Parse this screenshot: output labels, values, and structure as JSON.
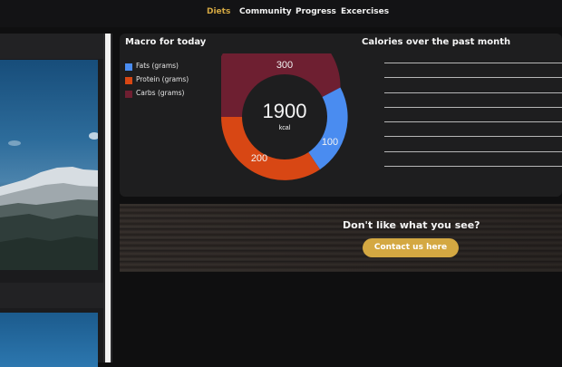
{
  "nav": {
    "items": [
      {
        "label": "Diets",
        "active": true
      },
      {
        "label": "Community",
        "active": false
      },
      {
        "label": "Progress",
        "active": false
      },
      {
        "label": "Excercises",
        "active": false
      }
    ],
    "active_color": "#d4a842"
  },
  "macro": {
    "title": "Macro for today",
    "legend": [
      {
        "label": "Fats (grams)",
        "color": "#4a8cf0"
      },
      {
        "label": "Protein (grams)",
        "color": "#d84714"
      },
      {
        "label": "Carbs (grams)",
        "color": "#6e1f31"
      }
    ],
    "center_value": "1900",
    "center_unit": "kcal",
    "segments": [
      {
        "value": 300,
        "color": "#6e1f31"
      },
      {
        "value": 100,
        "color": "#4a8cf0"
      },
      {
        "value": 200,
        "color": "#d84714"
      }
    ]
  },
  "calories": {
    "title": "Calories over the past month",
    "gridline_count": 8
  },
  "banner": {
    "headline": "Don't like what you see?",
    "cta_label": "Contact us here",
    "cta_color": "#d4a842"
  }
}
